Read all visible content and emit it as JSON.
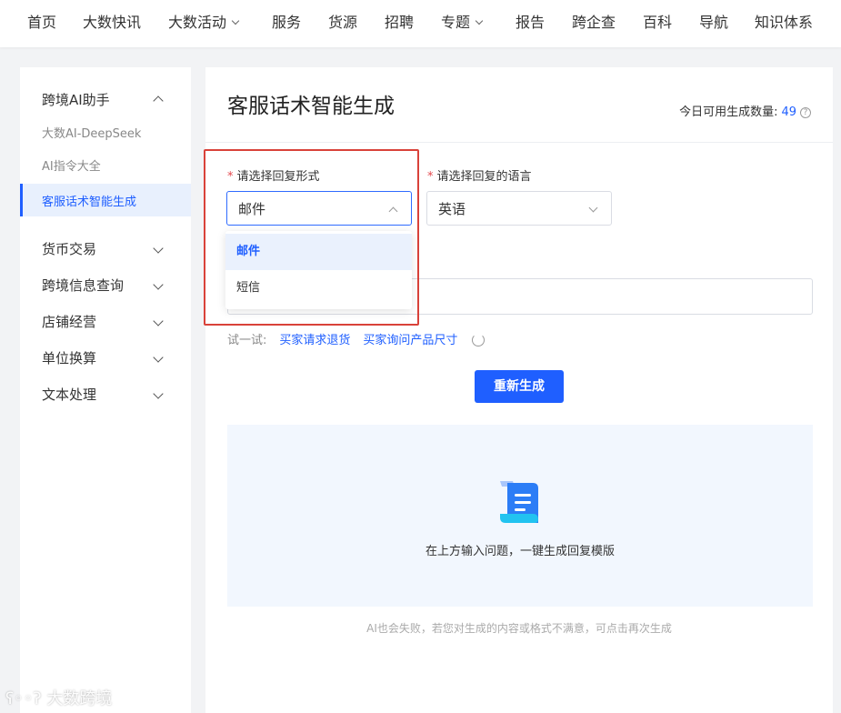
{
  "nav": {
    "items": [
      {
        "label": "首页"
      },
      {
        "label": "大数快讯"
      },
      {
        "label": "大数活动"
      },
      {
        "label": "服务"
      },
      {
        "label": "货源"
      },
      {
        "label": "招聘"
      },
      {
        "label": "专题"
      },
      {
        "label": "报告"
      },
      {
        "label": "跨企查"
      },
      {
        "label": "百科"
      },
      {
        "label": "导航"
      },
      {
        "label": "知识体系"
      }
    ]
  },
  "sidebar": {
    "group_ai": "跨境AI助手",
    "sub_items": [
      "大数AI-DeepSeek",
      "AI指令大全",
      "客服话术智能生成"
    ],
    "groups": [
      "货币交易",
      "跨境信息查询",
      "店铺经营",
      "单位换算",
      "文本处理"
    ]
  },
  "main": {
    "title": "客服话术智能生成",
    "quota_label": "今日可用生成数量:",
    "quota_value": "49",
    "help_glyph": "?",
    "reply_form_label": "请选择回复形式",
    "reply_form_value": "邮件",
    "reply_lang_label": "请选择回复的语言",
    "reply_lang_value": "英语",
    "required_mark": "*",
    "try_label": "试一试:",
    "try_links": [
      "买家请求退货",
      "买家询问产品尺寸"
    ],
    "regenerate_label": "重新生成",
    "result_hint": "在上方输入问题，一键生成回复模版",
    "footnote": "AI也会失败，若您对生成的内容或格式不满意，可点击再次生成"
  },
  "dropdown": {
    "options": [
      "邮件",
      "短信"
    ],
    "selected": "邮件"
  },
  "watermark": "大数跨境",
  "colors": {
    "accent": "#1f5fff",
    "highlight": "#d9423a",
    "required": "#e5484d"
  }
}
